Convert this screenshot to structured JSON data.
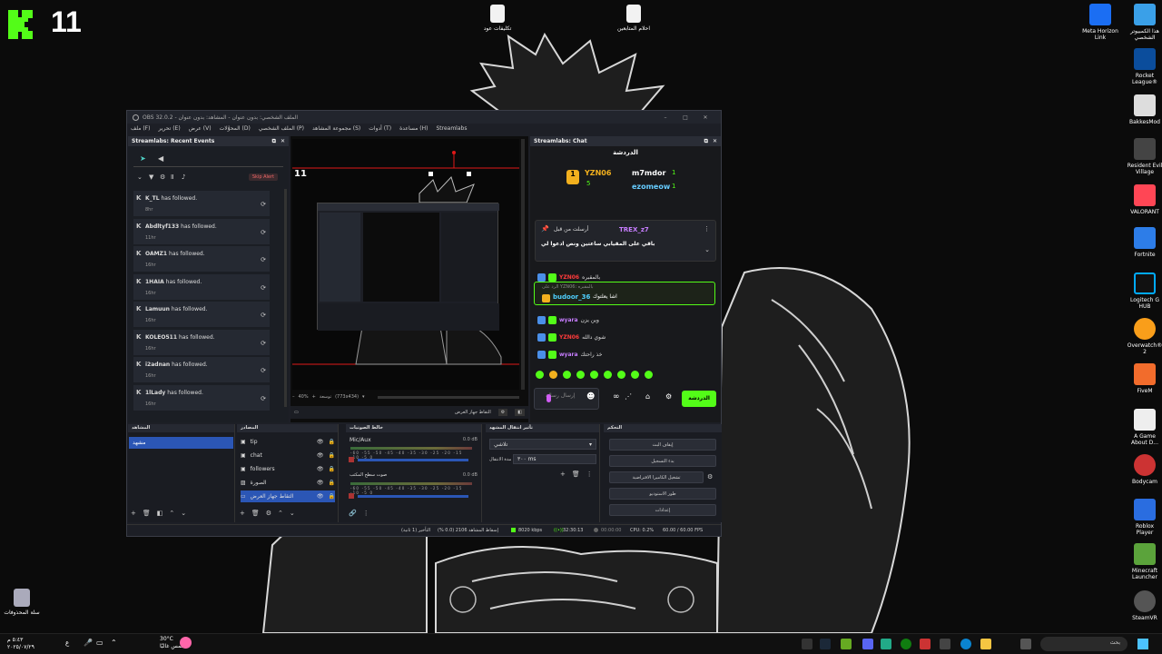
{
  "desktop": {
    "logo_number": "11",
    "files": [
      {
        "label": "تكليفات عود"
      },
      {
        "label": "احلام المتابعين"
      }
    ],
    "right_icons": [
      {
        "label": "هذا الكمبيوتر الشخصي"
      },
      {
        "label": "Meta Horizon Link"
      },
      {
        "label": "Rocket League®"
      },
      {
        "label": "BakkesMod"
      },
      {
        "label": "Resident Evil Village"
      },
      {
        "label": "VALORANT"
      },
      {
        "label": "Fortnite"
      },
      {
        "label": "Logitech G HUB"
      },
      {
        "label": "Overwatch® 2"
      },
      {
        "label": "FiveM"
      },
      {
        "label": "A Game About D..."
      },
      {
        "label": "Bodycam"
      },
      {
        "label": "Roblox Player"
      },
      {
        "label": "Minecraft Launcher"
      },
      {
        "label": "SteamVR"
      }
    ],
    "recycle_bin": "سلة المحذوفات"
  },
  "taskbar": {
    "weather_temp": "30°C",
    "weather_desc": "مشمس غالبًا",
    "clock_time": "٥:٤٣ م",
    "clock_date": "٢٠٢٥/٠٧/٢٩",
    "search_label": "بحث",
    "lang": "ع"
  },
  "obs": {
    "title": "OBS 32.0.2 - الملف الشخصي: بدون عنوان - المشاهد: بدون عنوان",
    "menu": [
      "ملف (F)",
      "تحرير (E)",
      "عرض (V)",
      "المحوَّلات (D)",
      "الملف الشخصي (P)",
      "مجموعة المشاهد (S)",
      "أدوات (T)",
      "مساعدة (H)",
      "Streamlabs"
    ],
    "events_dock": {
      "title": "Streamlabs: Recent Events",
      "skip_alert": "Skip Alert",
      "events": [
        {
          "name": "K_TL",
          "action": "has followed.",
          "time": "8hr"
        },
        {
          "name": "Abdltyf133",
          "action": "has followed.",
          "time": "11hr"
        },
        {
          "name": "OAMZ1",
          "action": "has followed.",
          "time": "16hr"
        },
        {
          "name": "1HAIA",
          "action": "has followed.",
          "time": "16hr"
        },
        {
          "name": "Lamuun",
          "action": "has followed.",
          "time": "16hr"
        },
        {
          "name": "KOLEO511",
          "action": "has followed.",
          "time": "16hr"
        },
        {
          "name": "i2adnan",
          "action": "has followed.",
          "time": "16hr"
        },
        {
          "name": "1lLady",
          "action": "has followed.",
          "time": "16hr"
        }
      ]
    },
    "preview": {
      "overlay_number": "11",
      "zoom": "40%",
      "fit_label": "توسعة",
      "resolution": "(773x434)",
      "source_name": "التقاط جهاز العرض"
    },
    "chat_dock": {
      "title": "Streamlabs: Chat",
      "header": "الدردشة",
      "leaderboard": [
        {
          "rank": "1",
          "name": "YZN06",
          "count": "5"
        },
        {
          "name": "m7mdor",
          "count": "1"
        },
        {
          "name": "ezomeow",
          "count": "1"
        }
      ],
      "pinned_by": "أرسلت من قبل",
      "pinned_user": "TREX_z7",
      "pinned_text": "باقي على المقيابي ساعتين ونص ادعوا لي",
      "messages": [
        {
          "user": "YZN06",
          "text": "بالمقبره",
          "color": "#ff3b3b"
        },
        {
          "reply": "الرد على YZN06: بالمقبره",
          "user": "budoor_36",
          "text": "اشا يعلتوك",
          "color": "#4fd1ff"
        },
        {
          "user": "wyara",
          "text": "وين يزن",
          "color": "#c77dff"
        },
        {
          "user": "YZN06",
          "text": "شوي دالله",
          "color": "#ff3b3b"
        },
        {
          "user": "wyara",
          "text": "خذ راحتك",
          "color": "#c77dff"
        }
      ],
      "input_placeholder": "إرسال رسالة",
      "send_label": "الدردشة"
    },
    "scenes": {
      "title": "المشاهد",
      "items": [
        "مشهد"
      ]
    },
    "sources": {
      "title": "المصادر",
      "items": [
        "tip",
        "chat",
        "followers",
        "الصورة",
        "التقاط جهاز العرض"
      ]
    },
    "mixer": {
      "title": "خالط الصوتيات",
      "channels": [
        {
          "name": "Mic/Aux",
          "db": "0.0 dB"
        },
        {
          "name": "صوت سطح المكتب",
          "db": "0.0 dB"
        }
      ],
      "ticks": "-60 -55 -50 -45 -40 -35 -30 -25 -20 -15 -10 -5 0"
    },
    "transitions": {
      "title": "تأثير انتقال المشهد",
      "type": "تلاشي",
      "duration_label": "مدة الانتقال",
      "duration": "٣٠٠ ms"
    },
    "controls": {
      "title": "التحكم",
      "buttons": [
        "إيقاف البث",
        "بدء التسجيل",
        "تشغيل الكاميرا الافتراضية",
        "طور الاستوديو",
        "إعدادات"
      ]
    },
    "status": {
      "delay": "التأخير (1 ثانية)",
      "dropped": "إسقاط المشاهد 2106 (0.0 %)",
      "bitrate": "8020 kbps",
      "stream_time": "32:30:13",
      "rec_time": "00:00:00",
      "cpu": "CPU: 0.2%",
      "fps": "60.00 / 60.00 FPS"
    }
  }
}
